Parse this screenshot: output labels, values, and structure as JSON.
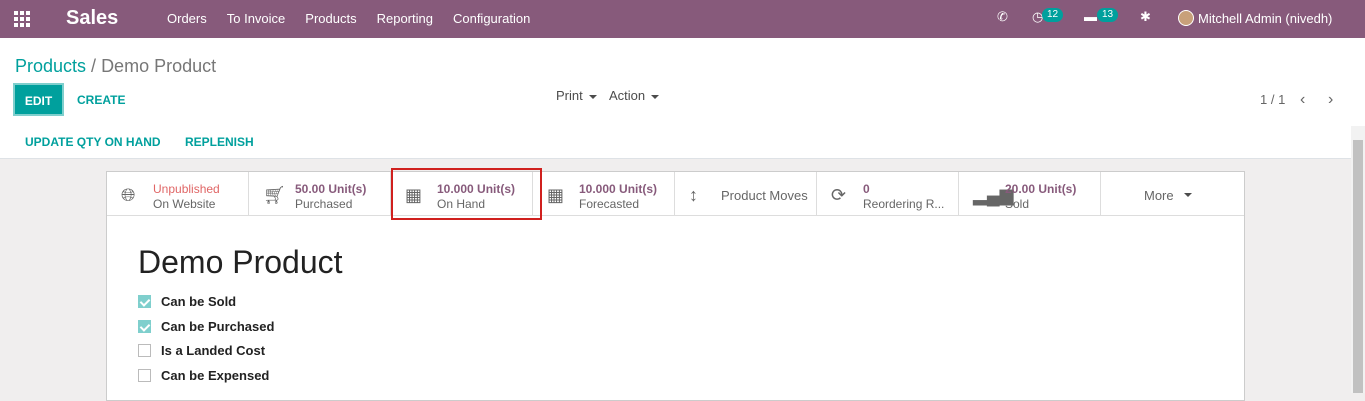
{
  "navbar": {
    "app_name": "Sales",
    "menu": [
      "Orders",
      "To Invoice",
      "Products",
      "Reporting",
      "Configuration"
    ],
    "activity_badge": "12",
    "messages_badge": "13",
    "user_name": "Mitchell Admin (nivedh)"
  },
  "breadcrumb": {
    "parent": "Products",
    "separator": "/",
    "current": "Demo Product"
  },
  "buttons": {
    "edit": "EDIT",
    "create": "CREATE",
    "print": "Print",
    "action": "Action"
  },
  "pager": {
    "value": "1 / 1"
  },
  "statusbar": {
    "update_qty": "UPDATE QTY ON HAND",
    "replenish": "REPLENISH"
  },
  "smart_buttons": [
    {
      "line1": "Unpublished",
      "line2": "On Website",
      "icon": "globe-icon"
    },
    {
      "line1": "50.00 Unit(s)",
      "line2": "Purchased",
      "icon": "cart-icon"
    },
    {
      "line1": "10.000 Unit(s)",
      "line2": "On Hand",
      "icon": "building-icon"
    },
    {
      "line1": "10.000 Unit(s)",
      "line2": "Forecasted",
      "icon": "building-icon"
    },
    {
      "single": "Product Moves",
      "icon": "arrows-vertical-icon"
    },
    {
      "line1": "0",
      "line2": "Reordering R...",
      "icon": "refresh-icon"
    },
    {
      "line1": "20.00 Unit(s)",
      "line2": "Sold",
      "icon": "signal-icon"
    },
    {
      "single": "More",
      "icon": "caret-down-icon"
    }
  ],
  "product": {
    "name": "Demo Product",
    "options": [
      {
        "label": "Can be Sold",
        "checked": true
      },
      {
        "label": "Can be Purchased",
        "checked": true
      },
      {
        "label": "Is a Landed Cost",
        "checked": false
      },
      {
        "label": "Can be Expensed",
        "checked": false
      }
    ]
  },
  "colors": {
    "navbar": "#875a7b",
    "primary": "#00a09d",
    "highlight_border": "#d0201e",
    "unpublished_text": "#e06666"
  }
}
